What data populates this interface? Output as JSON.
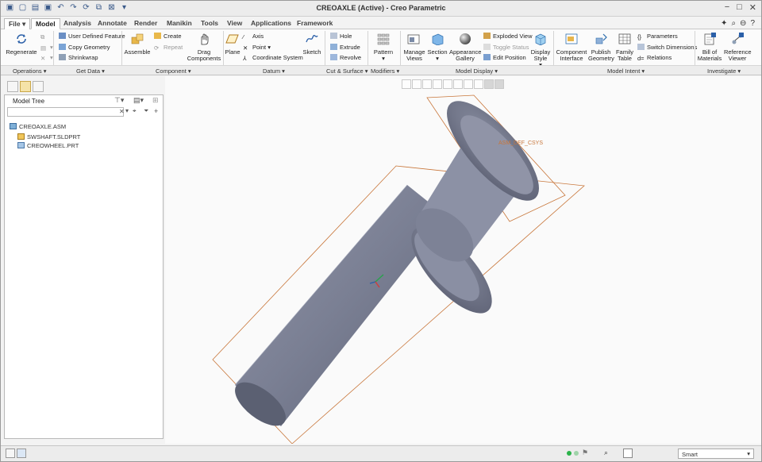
{
  "window": {
    "title": "CREOAXLE (Active) - Creo Parametric"
  },
  "tabs": {
    "file": "File",
    "items": [
      "Model",
      "Analysis",
      "Annotate",
      "Render",
      "Manikin",
      "Tools",
      "View",
      "Applications",
      "Framework"
    ],
    "active": "Model"
  },
  "ribbon": {
    "operations": {
      "regenerate": "Regenerate",
      "group": "Operations"
    },
    "get_data": {
      "user_defined": "User Defined Feature",
      "copy_geometry": "Copy Geometry",
      "shrinkwrap": "Shrinkwrap",
      "group": "Get Data"
    },
    "component": {
      "assemble": "Assemble",
      "create": "Create",
      "repeat": "Repeat",
      "drag": "Drag Components",
      "group": "Component"
    },
    "datum": {
      "plane": "Plane",
      "axis": "Axis",
      "point": "Point",
      "csys": "Coordinate System",
      "sketch": "Sketch",
      "group": "Datum"
    },
    "cut_surface": {
      "hole": "Hole",
      "extrude": "Extrude",
      "revolve": "Revolve",
      "group": "Cut & Surface"
    },
    "modifiers": {
      "pattern": "Pattern",
      "group": "Modifiers"
    },
    "model_display": {
      "manage_views": "Manage Views",
      "section": "Section",
      "appearance": "Appearance Gallery",
      "exploded": "Exploded View",
      "toggle_status": "Toggle Status",
      "edit_position": "Edit Position",
      "display_style": "Display Style",
      "group": "Model Display"
    },
    "model_intent": {
      "component_interface": "Component Interface",
      "publish_geometry": "Publish Geometry",
      "family_table": "Family Table",
      "parameters": "Parameters",
      "switch_dimensions": "Switch Dimensions",
      "relations": "Relations",
      "group": "Model Intent"
    },
    "investigate": {
      "bom": "Bill of Materials",
      "reference_viewer": "Reference Viewer",
      "group": "Investigate"
    }
  },
  "model_tree": {
    "title": "Model Tree",
    "search_placeholder": "",
    "items": [
      "CREOAXLE.ASM",
      "SWSHAFT.SLDPRT",
      "CREOWHEEL.PRT"
    ]
  },
  "viewport": {
    "csys_label": "ASM_DEF_CSYS"
  },
  "statusbar": {
    "filter": "Smart"
  },
  "colors": {
    "model_fill": "#7a7f93",
    "bbox_line": "#c8763a",
    "accent_blue": "#2a5fa8"
  }
}
